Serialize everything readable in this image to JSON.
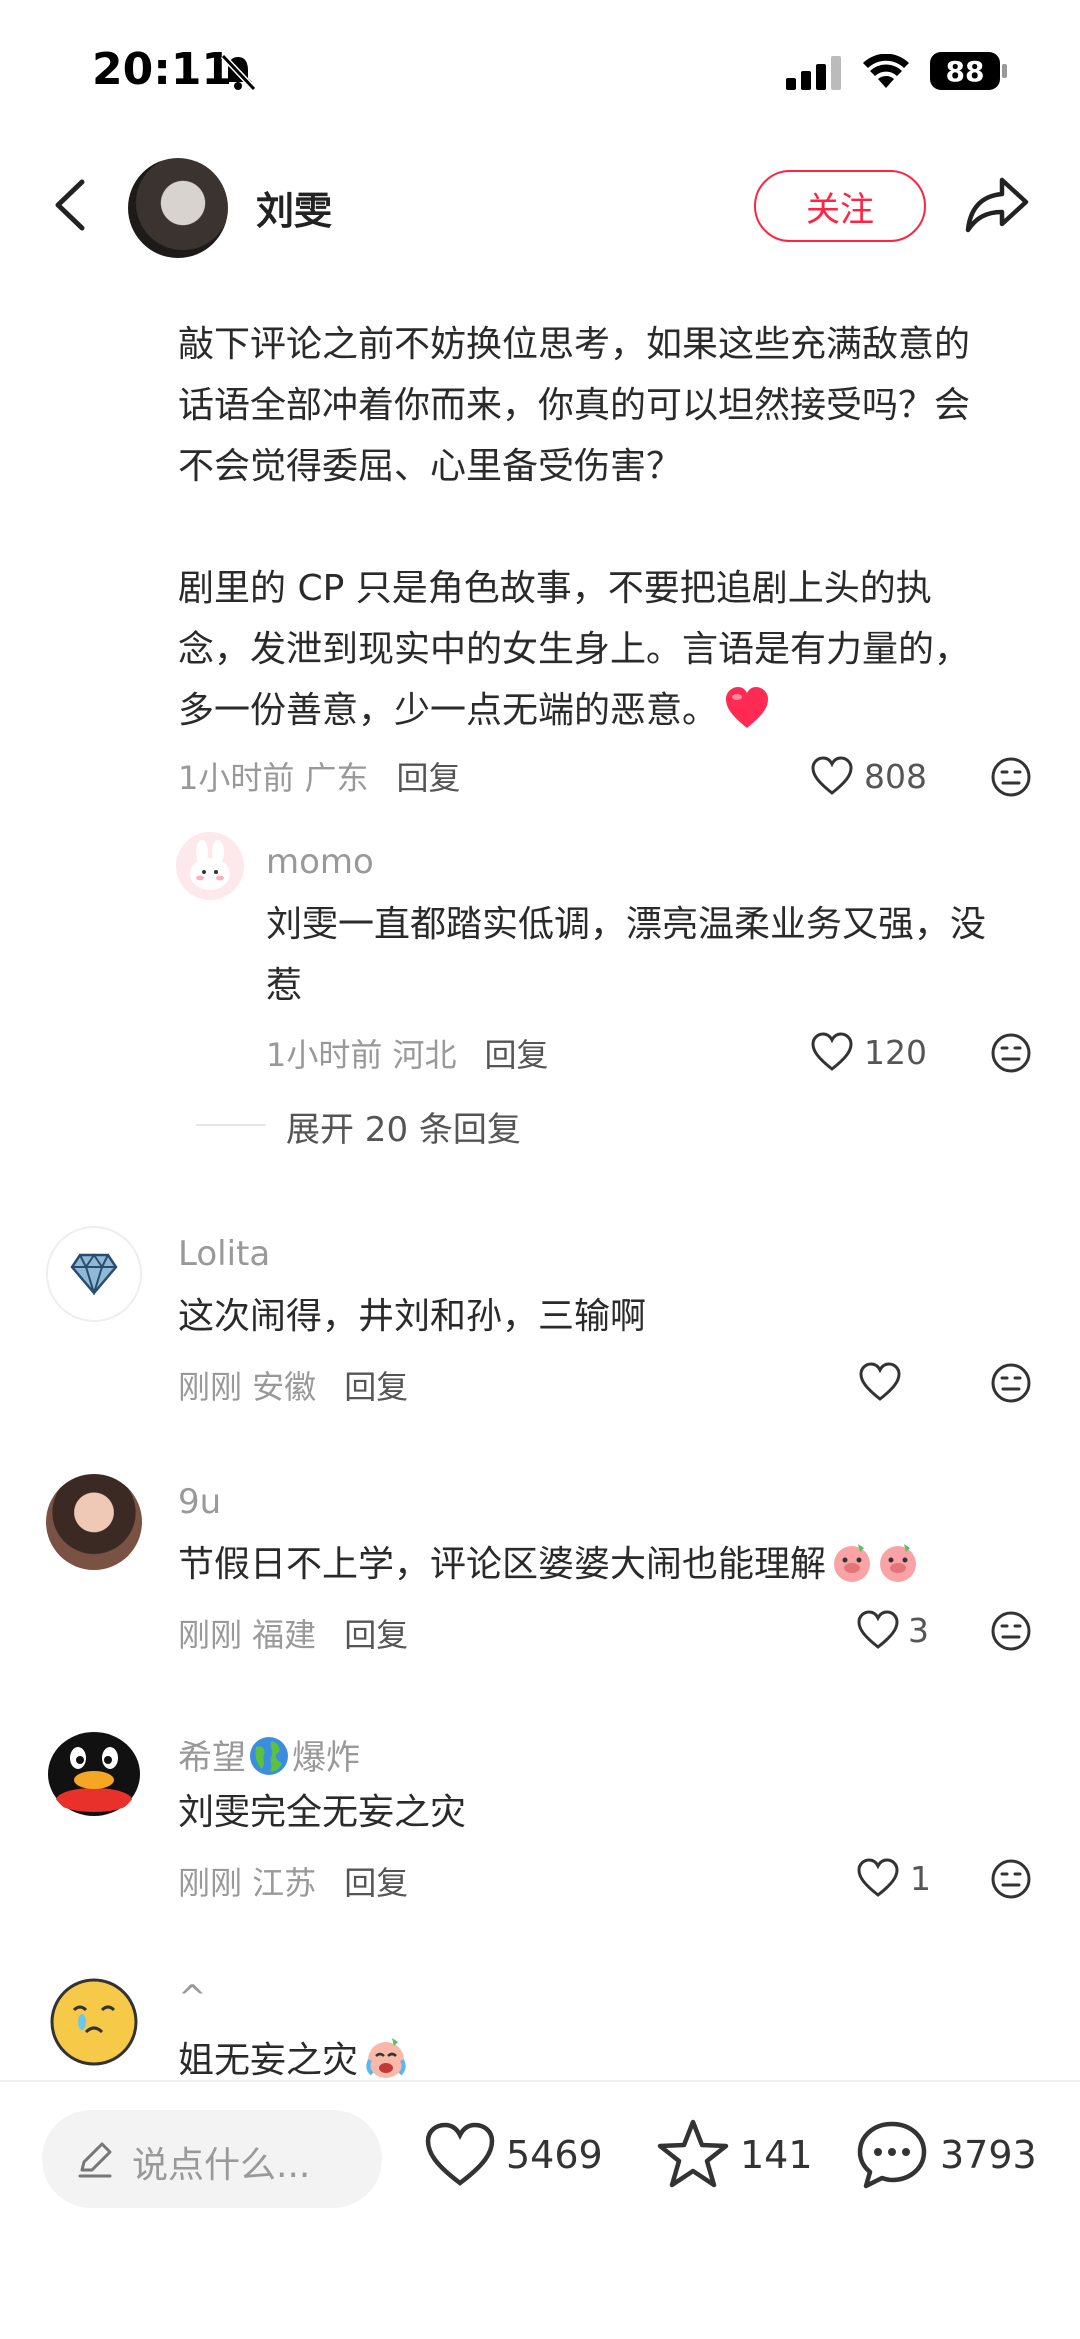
{
  "status_bar": {
    "time": "20:11",
    "battery": "88"
  },
  "header": {
    "author_name": "刘雯",
    "follow_label": "关注"
  },
  "main_comment": {
    "lines": [
      "敲下评论之前不妨换位思考，如果这些充满敌意的",
      "话语全部冲着你而来，你真的可以坦然接受吗？会",
      "不会觉得委屈、心里备受伤害？",
      "",
      "剧里的 CP 只是角色故事，不要把追剧上头的执",
      "念，发泄到现实中的女生身上。言语是有力量的，",
      "多一份善意，少一点无端的恶意。"
    ],
    "meta": "1小时前 广东",
    "reply_label": "回复",
    "likes": "808"
  },
  "sub_reply": {
    "username": "momo",
    "lines": [
      "刘雯一直都踏实低调，漂亮温柔业务又强，没",
      "惹"
    ],
    "meta": "1小时前 河北",
    "reply_label": "回复",
    "likes": "120"
  },
  "expand_label": "展开 20 条回复",
  "comments": [
    {
      "username": "Lolita",
      "text": "这次闹得，井刘和孙，三输啊",
      "meta": "刚刚 安徽",
      "reply_label": "回复",
      "likes": ""
    },
    {
      "username": "9u",
      "text": "节假日不上学，评论区婆婆大闹也能理解",
      "meta": "刚刚 福建",
      "reply_label": "回复",
      "likes": "3"
    },
    {
      "username_a": "希望",
      "username_b": "爆炸",
      "text": "刘雯完全无妄之灾",
      "meta": "刚刚 江苏",
      "reply_label": "回复",
      "likes": "1"
    },
    {
      "username": "^",
      "text": "姐无妄之灾"
    }
  ],
  "bottom_bar": {
    "input_placeholder": "说点什么...",
    "likes": "5469",
    "stars": "141",
    "comments": "3793"
  },
  "colors": {
    "accent": "#ff2442",
    "muted": "#999999",
    "heart": "#ff2b55"
  }
}
